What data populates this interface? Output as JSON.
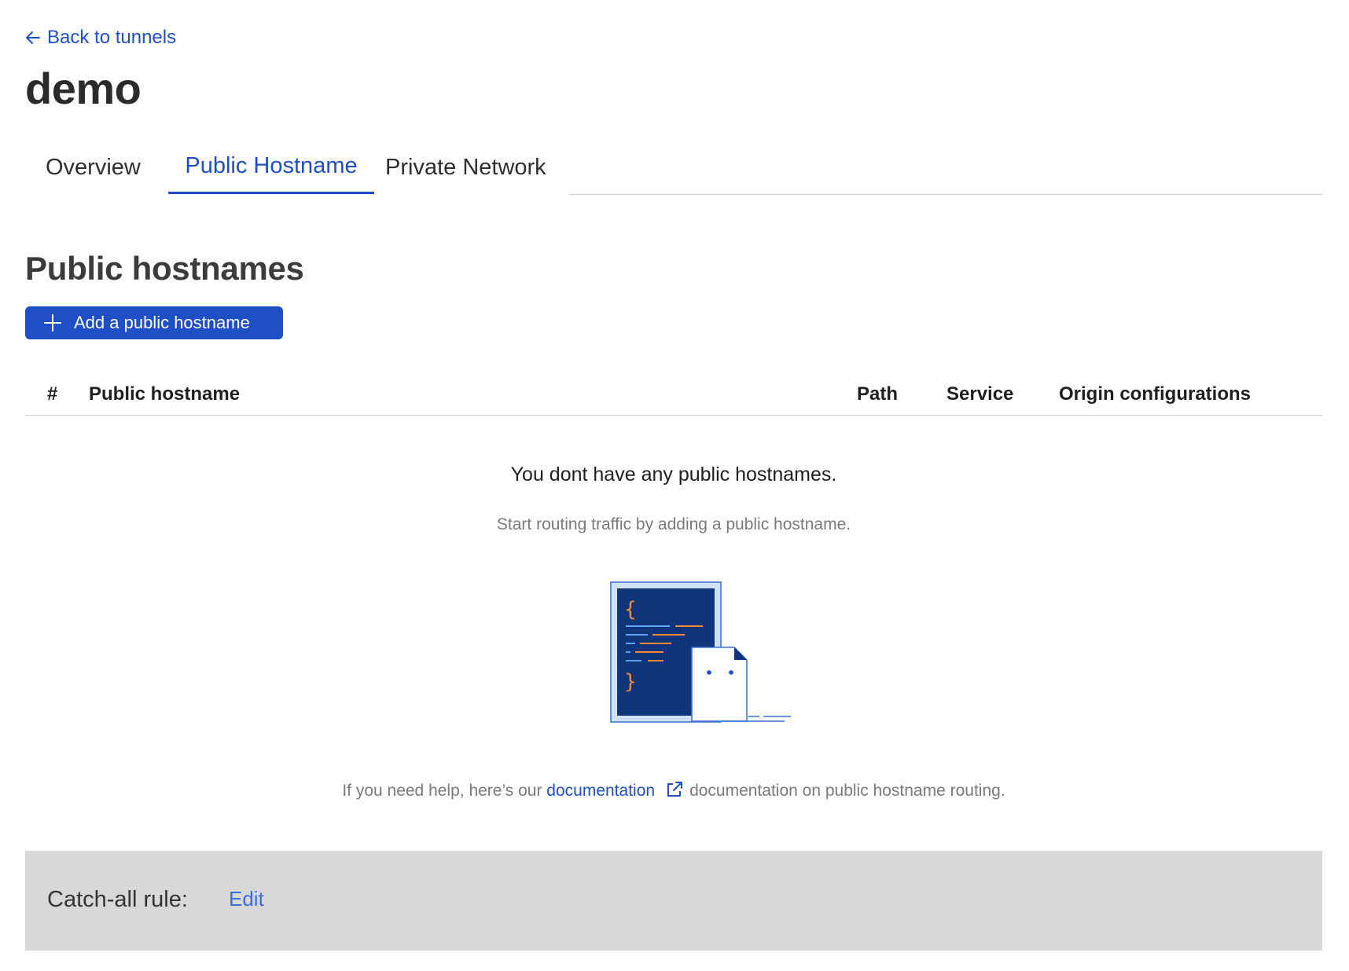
{
  "back_link": {
    "label": "Back to tunnels",
    "icon": "arrow-left-icon"
  },
  "page_title": "demo",
  "tabs": [
    {
      "label": "Overview",
      "active": false
    },
    {
      "label": "Public Hostname",
      "active": true
    },
    {
      "label": "Private Network",
      "active": false
    }
  ],
  "section_title": "Public hostnames",
  "add_button": {
    "label": "Add a public hostname",
    "icon": "plus-icon"
  },
  "table": {
    "columns": [
      "#",
      "Public hostname",
      "Path",
      "Service",
      "Origin configurations"
    ]
  },
  "empty_state": {
    "title": "You dont have any public hostnames.",
    "subtitle": "Start routing traffic by adding a public hostname.",
    "illustration": "code-document-illustration"
  },
  "help": {
    "prefix": "If you need help, here’s our",
    "link_label": "documentation",
    "link_icon": "external-link-icon",
    "suffix": "documentation on public hostname routing."
  },
  "catch_all": {
    "label": "Catch-all rule:",
    "edit_label": "Edit"
  },
  "colors": {
    "accent": "#1f4fc4",
    "catch_all_bg": "#d8d8d8",
    "illustration_navy": "#11357a",
    "illustration_orange": "#f48a36"
  }
}
